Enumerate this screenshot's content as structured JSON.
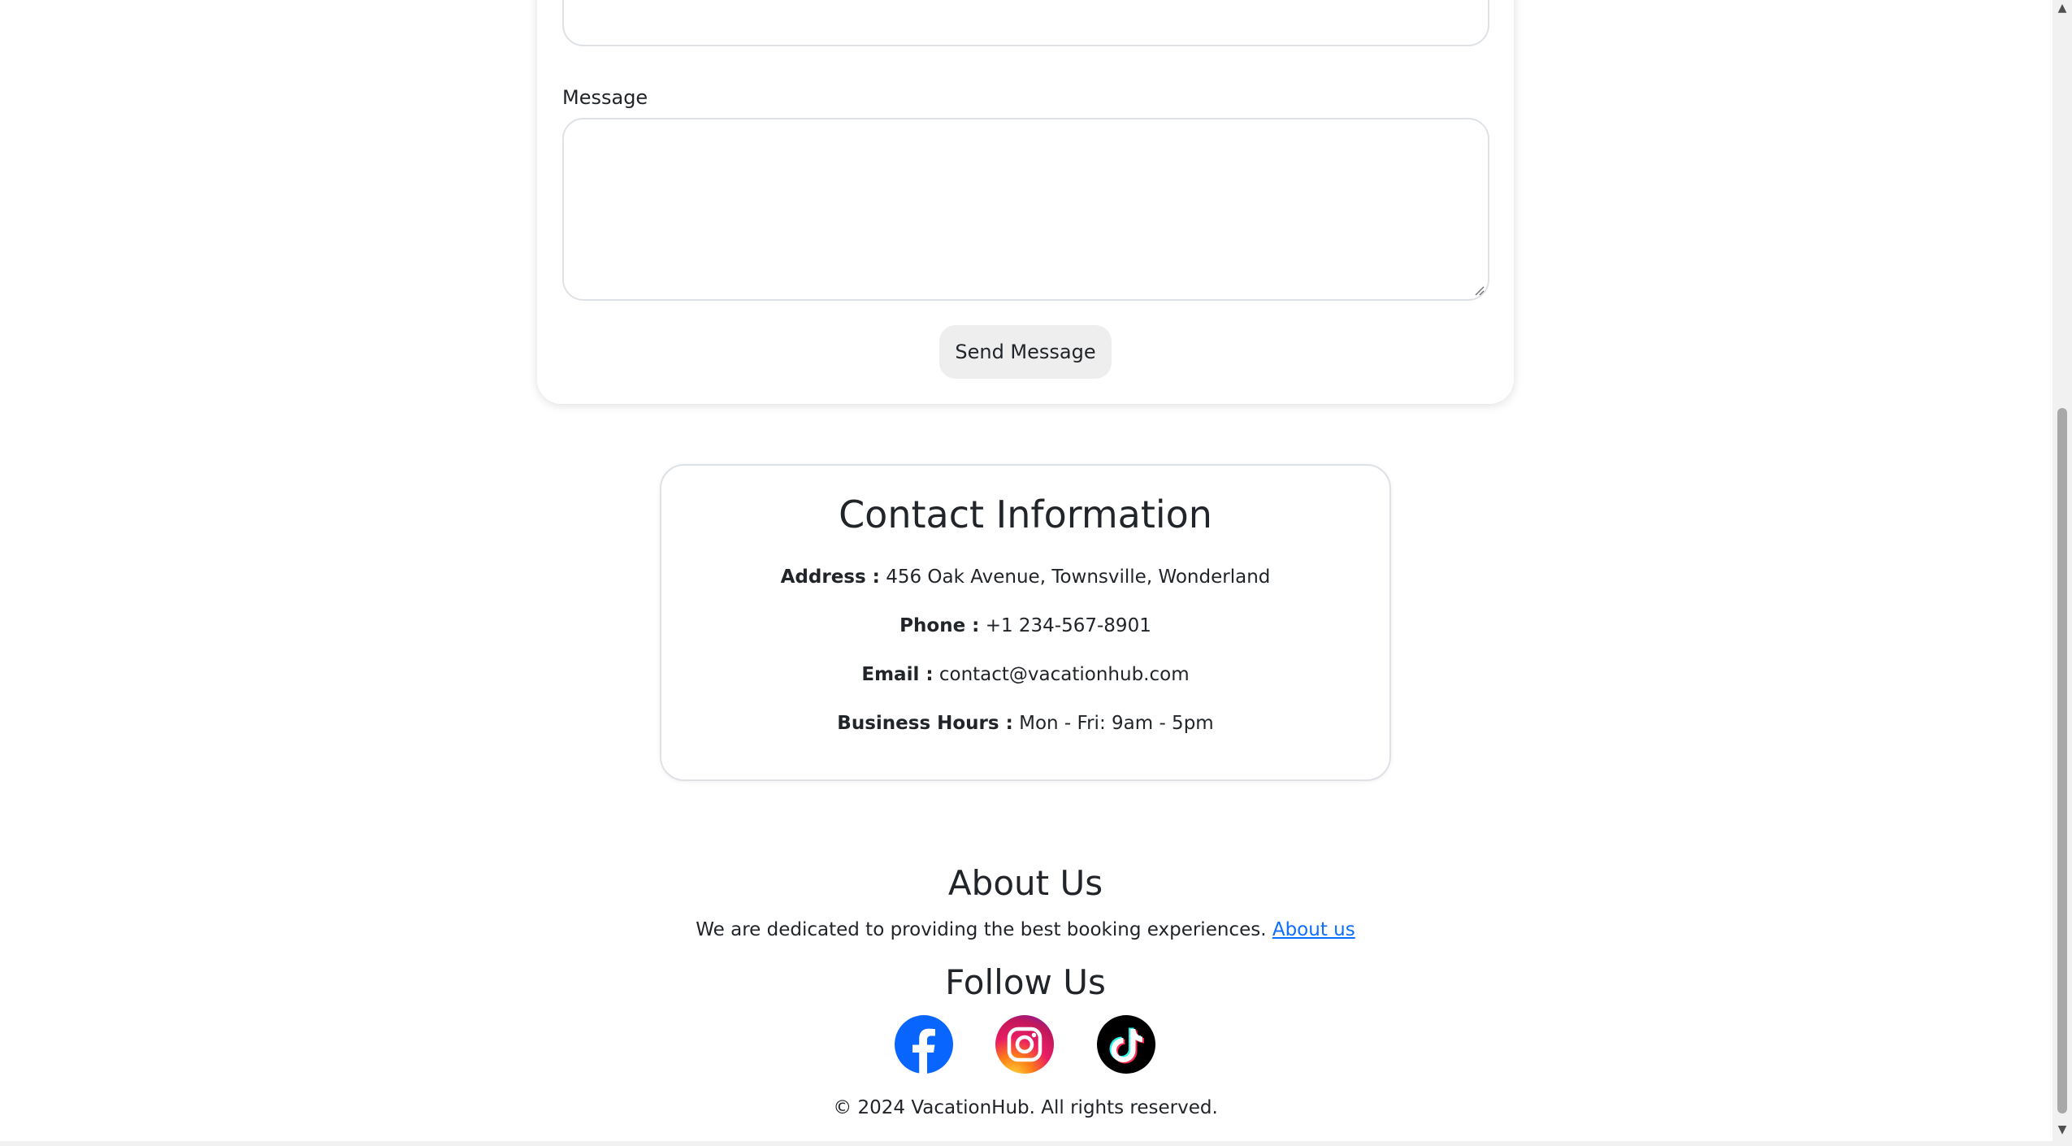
{
  "form": {
    "message_label": "Message",
    "send_button": "Send Message"
  },
  "contact_info": {
    "title": "Contact Information",
    "address_label": "Address :",
    "address_value": "456 Oak Avenue, Townsville, Wonderland",
    "phone_label": "Phone :",
    "phone_value": "+1 234-567-8901",
    "email_label": "Email :",
    "email_value": "contact@vacationhub.com",
    "hours_label": "Business Hours :",
    "hours_value": "Mon - Fri: 9am - 5pm"
  },
  "footer": {
    "about_title": "About Us",
    "about_text": "We are dedicated to providing the best booking experiences.",
    "about_link": "About us",
    "follow_title": "Follow Us",
    "social_icons": [
      "facebook-icon",
      "instagram-icon",
      "tiktok-icon"
    ],
    "copyright": "© 2024 VacationHub. All rights reserved."
  },
  "colors": {
    "link": "#0d6efd",
    "facebook": "#0866ff",
    "button_bg": "#eeeeee",
    "border": "#dee2e6"
  }
}
